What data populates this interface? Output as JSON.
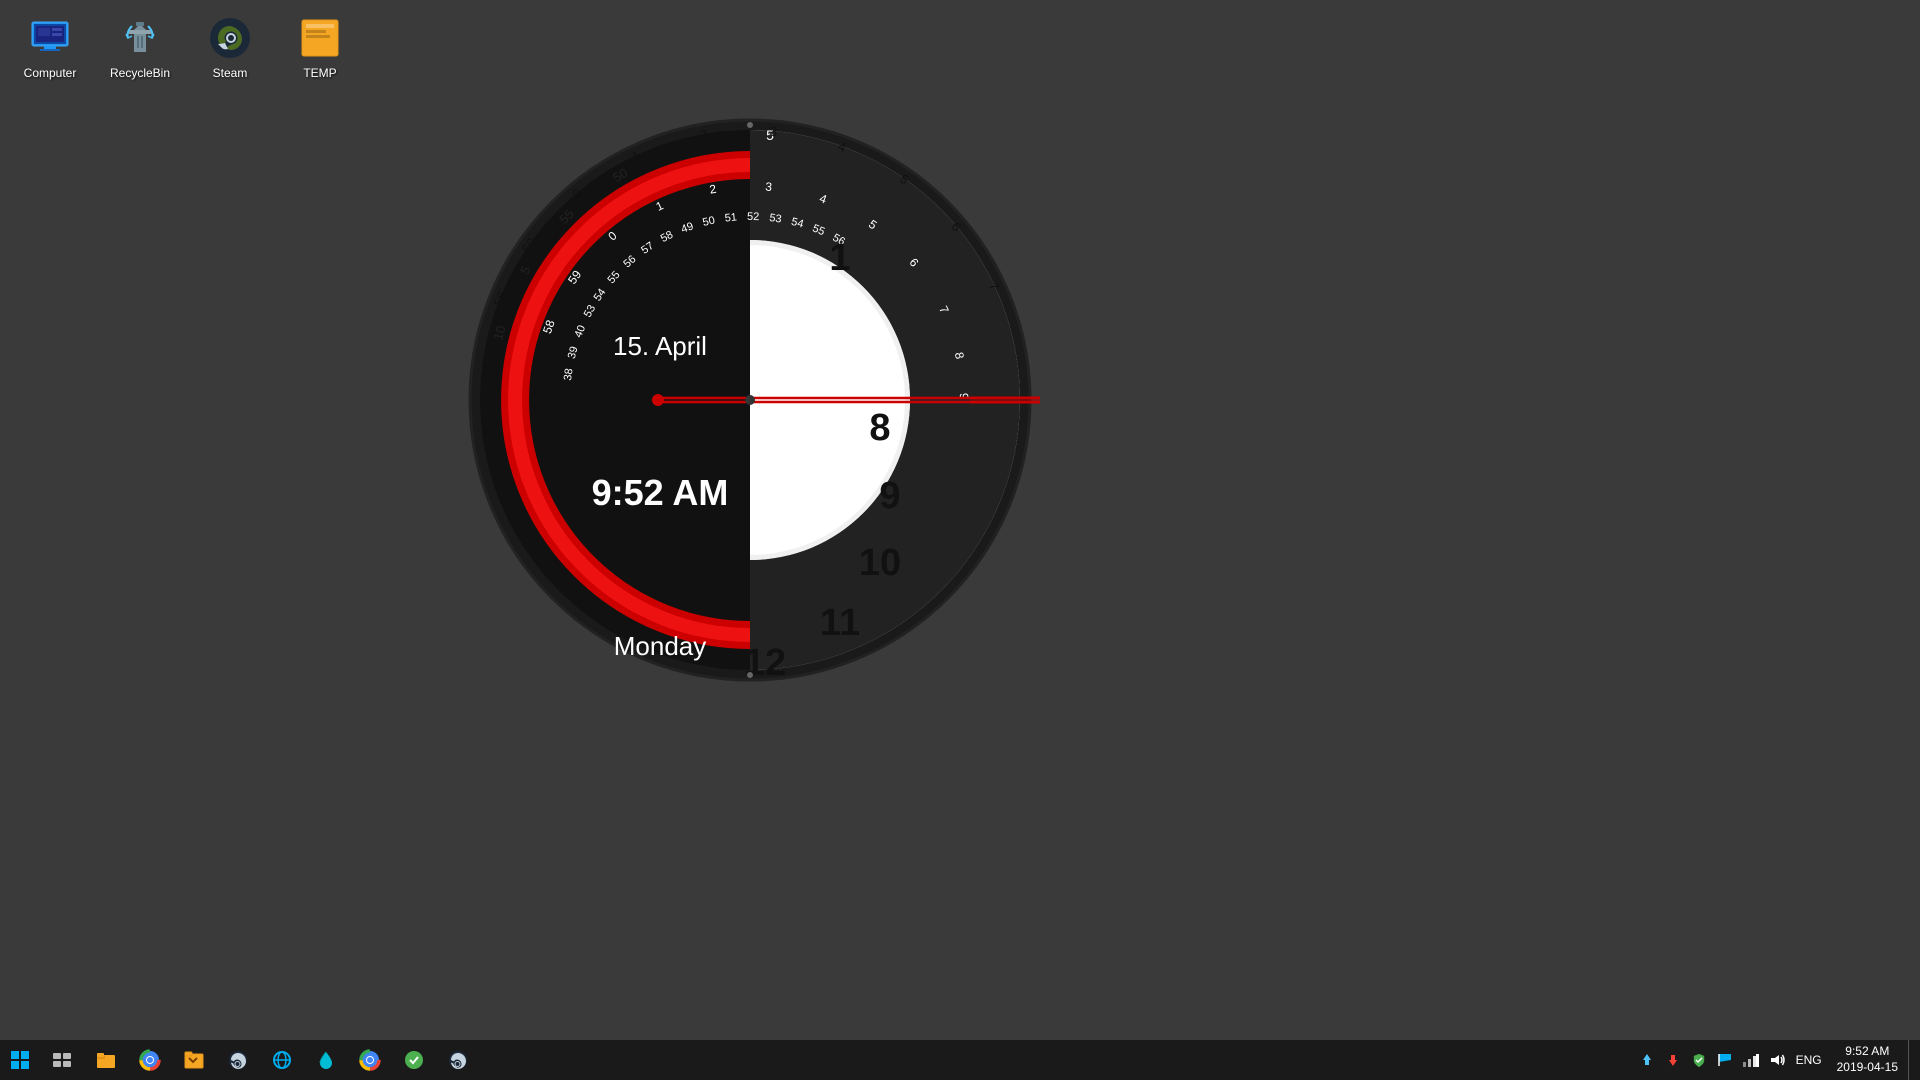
{
  "desktop": {
    "icons": [
      {
        "id": "computer",
        "label": "Computer"
      },
      {
        "id": "recyclebin",
        "label": "RecycleBin"
      },
      {
        "id": "steam",
        "label": "Steam"
      },
      {
        "id": "temp",
        "label": "TEMP"
      }
    ],
    "background_color": "#3a3a3a"
  },
  "clock": {
    "time": "9:52 AM",
    "date": "15. April",
    "day": "Monday",
    "minutes_value": 52
  },
  "taskbar": {
    "start_label": "Start",
    "tray_time": "9:52 AM",
    "tray_date": "2019-04-15",
    "tray_lang": "ENG",
    "taskbar_apps": [
      {
        "id": "task-view",
        "label": "Task View"
      },
      {
        "id": "file-explorer-yellow",
        "label": "File Manager"
      },
      {
        "id": "chrome",
        "label": "Google Chrome"
      },
      {
        "id": "explorer",
        "label": "File Explorer"
      },
      {
        "id": "steam-task",
        "label": "Steam"
      },
      {
        "id": "ie",
        "label": "Internet Explorer"
      },
      {
        "id": "drop",
        "label": "Dropit"
      },
      {
        "id": "chrome2",
        "label": "Google Chrome 2"
      },
      {
        "id": "app1",
        "label": "App"
      },
      {
        "id": "steam2",
        "label": "Steam 2"
      }
    ],
    "tray_icons": [
      "network-up",
      "network-down",
      "shield",
      "windows-defender",
      "network",
      "volume",
      "lang"
    ]
  }
}
